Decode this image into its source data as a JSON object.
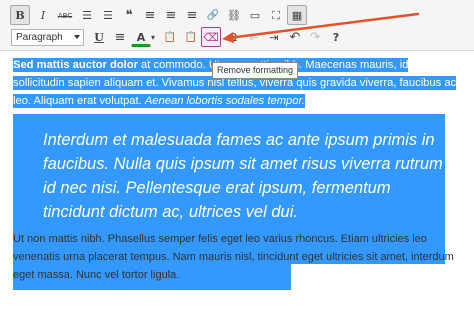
{
  "toolbar": {
    "format_select": "Paragraph",
    "tooltip": "Remove formatting",
    "row1": [
      {
        "name": "bold-icon",
        "glyph": "B"
      },
      {
        "name": "italic-icon",
        "glyph": "I"
      },
      {
        "name": "strikethrough-icon",
        "glyph": "ABC"
      },
      {
        "name": "bullet-list-icon",
        "glyph": "☰"
      },
      {
        "name": "numbered-list-icon",
        "glyph": "☰"
      },
      {
        "name": "blockquote-icon",
        "glyph": "❝"
      },
      {
        "name": "align-left-icon",
        "glyph": "≡"
      },
      {
        "name": "align-center-icon",
        "glyph": "≡"
      },
      {
        "name": "align-right-icon",
        "glyph": "≡"
      },
      {
        "name": "insert-link-icon",
        "glyph": "🔗"
      },
      {
        "name": "unlink-icon",
        "glyph": "⛓"
      },
      {
        "name": "more-tag-icon",
        "glyph": "▭"
      },
      {
        "name": "fullscreen-icon",
        "glyph": "⛶"
      },
      {
        "name": "toolbar-toggle-icon",
        "glyph": "▦"
      }
    ],
    "row2": [
      {
        "name": "underline-icon",
        "glyph": "U"
      },
      {
        "name": "justify-icon",
        "glyph": "≡"
      },
      {
        "name": "text-color-icon",
        "glyph": "A"
      },
      {
        "name": "paste-text-icon",
        "glyph": "📋"
      },
      {
        "name": "paste-word-icon",
        "glyph": "📋"
      },
      {
        "name": "remove-formatting-icon",
        "glyph": "⌫"
      },
      {
        "name": "special-character-icon",
        "glyph": "Ω"
      },
      {
        "name": "outdent-icon",
        "glyph": "⇤"
      },
      {
        "name": "indent-icon",
        "glyph": "⇥"
      },
      {
        "name": "undo-icon",
        "glyph": "↶"
      },
      {
        "name": "redo-icon",
        "glyph": "↷"
      },
      {
        "name": "help-icon",
        "glyph": "?"
      }
    ]
  },
  "content": {
    "p1_bold": "Sed mattis auctor dolor",
    "p1_rest": " at commodo. Ut non mattis nibh. Maecenas mauris, id sollicitudin sapien aliquam et. Vivamus nisl tellus, viverra quis gravida viverra, faucibus ac leo. Aliquam erat volutpat. ",
    "p1_italic": "Aenean lobortis sodales tempor.",
    "quote": "Interdum et malesuada fames ac ante ipsum primis in faucibus. Nulla quis ipsum sit amet risus viverra rutrum id nec nisi. Pellentesque erat ipsum, fermentum tincidunt dictum ac, ultrices vel dui.",
    "p2": "Ut non mattis nibh. Phasellus semper felis eget leo varius rhoncus. Etiam ultricies leo venenatis urna placerat tempus. Nam mauris nisl, tincidunt eget ultricies sit amet, interdum eget massa. Nunc vel tortor ligula."
  },
  "colors": {
    "selection": "#3399ff",
    "arrow": "#e0522a",
    "highlight_border": "#b33a8a"
  }
}
